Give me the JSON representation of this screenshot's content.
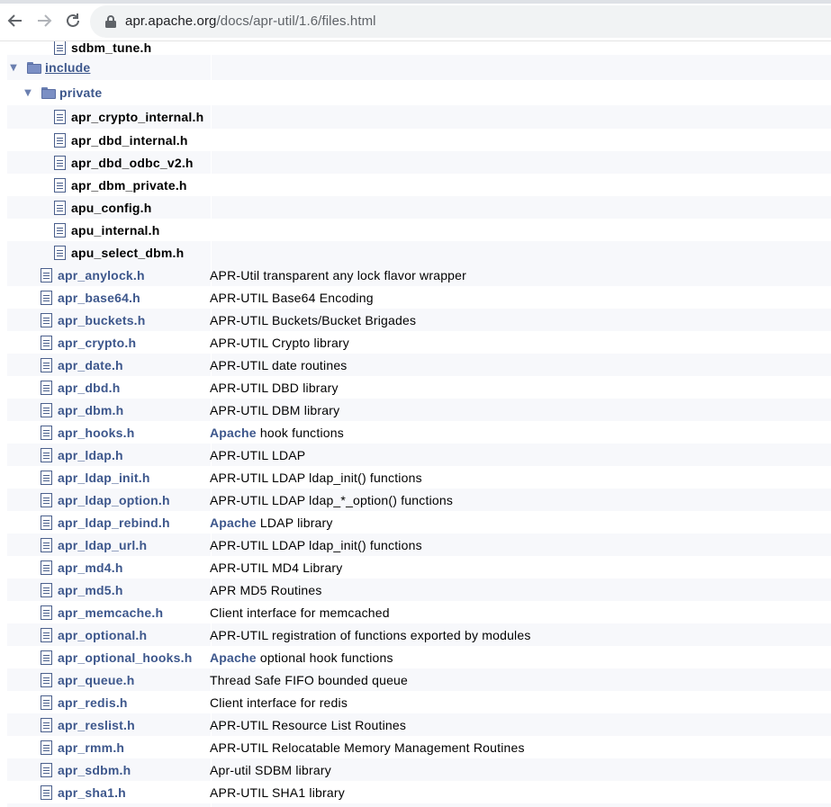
{
  "browser": {
    "url_host": "apr.apache.org",
    "url_path": "/docs/apr-util/1.6/files.html"
  },
  "tree": {
    "partial_top_file": "sdbm_tune.h",
    "include_folder": "include",
    "private_folder": "private",
    "private_files": [
      "apr_crypto_internal.h",
      "apr_dbd_internal.h",
      "apr_dbd_odbc_v2.h",
      "apr_dbm_private.h",
      "apu_config.h",
      "apu_internal.h",
      "apu_select_dbm.h"
    ],
    "files": [
      {
        "name": "apr_anylock.h",
        "desc": "APR-Util transparent any lock flavor wrapper"
      },
      {
        "name": "apr_base64.h",
        "desc": "APR-UTIL Base64 Encoding"
      },
      {
        "name": "apr_buckets.h",
        "desc": "APR-UTIL Buckets/Bucket Brigades"
      },
      {
        "name": "apr_crypto.h",
        "desc": "APR-UTIL Crypto library"
      },
      {
        "name": "apr_date.h",
        "desc": "APR-UTIL date routines"
      },
      {
        "name": "apr_dbd.h",
        "desc": "APR-UTIL DBD library"
      },
      {
        "name": "apr_dbm.h",
        "desc": "APR-UTIL DBM library"
      },
      {
        "name": "apr_hooks.h",
        "desc_link": "Apache",
        "desc": "hook functions"
      },
      {
        "name": "apr_ldap.h",
        "desc": "APR-UTIL LDAP"
      },
      {
        "name": "apr_ldap_init.h",
        "desc": "APR-UTIL LDAP ldap_init() functions"
      },
      {
        "name": "apr_ldap_option.h",
        "desc": "APR-UTIL LDAP ldap_*_option() functions"
      },
      {
        "name": "apr_ldap_rebind.h",
        "desc_link": "Apache",
        "desc": "LDAP library"
      },
      {
        "name": "apr_ldap_url.h",
        "desc": "APR-UTIL LDAP ldap_init() functions"
      },
      {
        "name": "apr_md4.h",
        "desc": "APR-UTIL MD4 Library"
      },
      {
        "name": "apr_md5.h",
        "desc": "APR MD5 Routines"
      },
      {
        "name": "apr_memcache.h",
        "desc": "Client interface for memcached"
      },
      {
        "name": "apr_optional.h",
        "desc": "APR-UTIL registration of functions exported by modules"
      },
      {
        "name": "apr_optional_hooks.h",
        "desc_link": "Apache",
        "desc": "optional hook functions"
      },
      {
        "name": "apr_queue.h",
        "desc": "Thread Safe FIFO bounded queue"
      },
      {
        "name": "apr_redis.h",
        "desc": "Client interface for redis"
      },
      {
        "name": "apr_reslist.h",
        "desc": "APR-UTIL Resource List Routines"
      },
      {
        "name": "apr_rmm.h",
        "desc": "APR-UTIL Relocatable Memory Management Routines"
      },
      {
        "name": "apr_sdbm.h",
        "desc": "Apr-util SDBM library"
      },
      {
        "name": "apr_sha1.h",
        "desc": "APR-UTIL SHA1 library"
      }
    ]
  },
  "colors": {
    "link": "#3d578c",
    "row_alt": "#f7f8fb"
  }
}
